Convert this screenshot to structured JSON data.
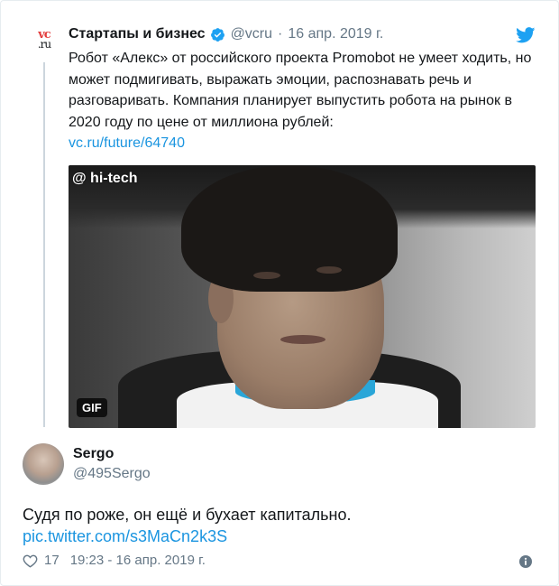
{
  "quoted_tweet": {
    "avatar_text": [
      "vc",
      ".ru"
    ],
    "name": "Стартапы и бизнес",
    "handle": "@vcru",
    "separator": "·",
    "date": "16 апр. 2019 г.",
    "text": "Робот «Алекс» от российского проекта Promobot не умеет ходить, но может подмигивать, выражать эмоции, распознавать речь и разговаривать. Компания планирует выпустить робота на рынок в 2020 году по цене от миллиона рублей:",
    "link": "vc.ru/future/64740",
    "media": {
      "watermark": "@ hi-tech",
      "badge": "GIF"
    }
  },
  "reply_tweet": {
    "name": "Sergo",
    "handle": "@495Sergo",
    "text": "Судя по роже, он ещё и бухает капитально.",
    "link": "pic.twitter.com/s3MaCn2k3S",
    "likes": "17",
    "timestamp": "19:23 - 16 апр. 2019 г."
  },
  "colors": {
    "link": "#1b95e0",
    "verified": "#1da1f2",
    "twitter_bird": "#1da1f2",
    "muted": "#657786"
  },
  "icons": [
    "verified-badge-icon",
    "twitter-bird-icon",
    "heart-icon",
    "info-icon"
  ]
}
